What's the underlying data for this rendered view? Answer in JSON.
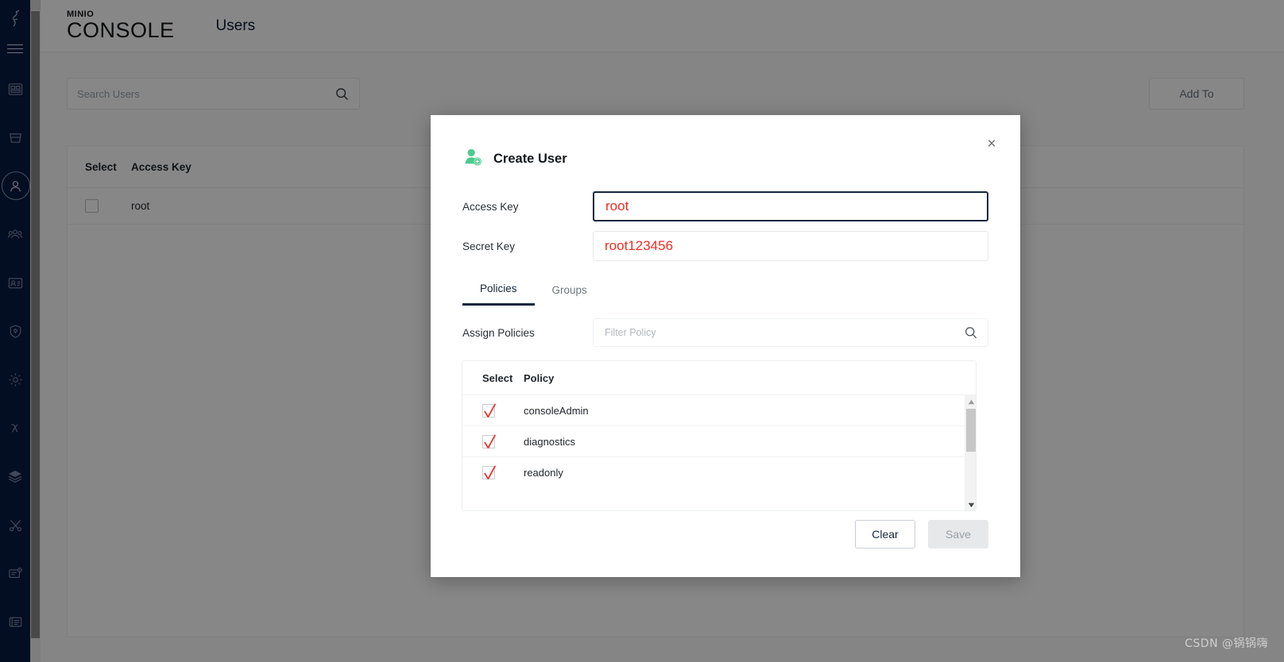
{
  "app": {
    "brand_line1": "MINIO",
    "brand_line2": "CONSOLE",
    "page_title": "Users",
    "watermark": "CSDN @锅锅嗨"
  },
  "sidebar": {
    "items": [
      {
        "label": "Dashboard",
        "icon": "dashboard-icon",
        "active": false
      },
      {
        "label": "Buckets",
        "icon": "bucket-icon",
        "active": false
      },
      {
        "label": "Users",
        "icon": "user-icon",
        "active": true
      },
      {
        "label": "Groups",
        "icon": "groups-icon",
        "active": false
      },
      {
        "label": "Account",
        "icon": "id-card-icon",
        "active": false
      },
      {
        "label": "IAM Policies",
        "icon": "shield-icon",
        "active": false
      },
      {
        "label": "Settings",
        "icon": "gear-icon",
        "active": false
      },
      {
        "label": "Lambda Notifications",
        "icon": "lambda-icon",
        "active": false
      },
      {
        "label": "Tiers",
        "icon": "layers-icon",
        "active": false
      },
      {
        "label": "Tools",
        "icon": "tools-icon",
        "active": false
      },
      {
        "label": "License",
        "icon": "license-icon",
        "active": false
      },
      {
        "label": "Documentation",
        "icon": "book-icon",
        "active": false
      }
    ]
  },
  "toolbar": {
    "search_placeholder": "Search Users",
    "search_value": "",
    "add_button_label": "Add To"
  },
  "users_table": {
    "columns": [
      "Select",
      "Access Key"
    ],
    "rows": [
      {
        "selected": false,
        "access_key": "root"
      }
    ]
  },
  "dialog": {
    "title": "Create User",
    "close_label": "×",
    "fields": [
      {
        "label": "Access Key",
        "value": "root",
        "placeholder": "",
        "focused": true
      },
      {
        "label": "Secret Key",
        "value": "root123456",
        "placeholder": "",
        "focused": false
      }
    ],
    "tabs": [
      {
        "label": "Policies",
        "active": true
      },
      {
        "label": "Groups",
        "active": false
      }
    ],
    "assign": {
      "label": "Assign Policies",
      "filter_placeholder": "Filter Policy",
      "filter_value": ""
    },
    "policy_table": {
      "columns": [
        "Select",
        "Policy"
      ],
      "rows": [
        {
          "selected": true,
          "policy": "consoleAdmin"
        },
        {
          "selected": true,
          "policy": "diagnostics"
        },
        {
          "selected": true,
          "policy": "readonly"
        }
      ]
    },
    "buttons": {
      "clear": "Clear",
      "save": "Save"
    }
  },
  "colors": {
    "sidebar_bg": "#081c42",
    "accent": "#16263f",
    "annotation_red": "#ee2d24",
    "avatar_green": "#4ccb8d"
  }
}
